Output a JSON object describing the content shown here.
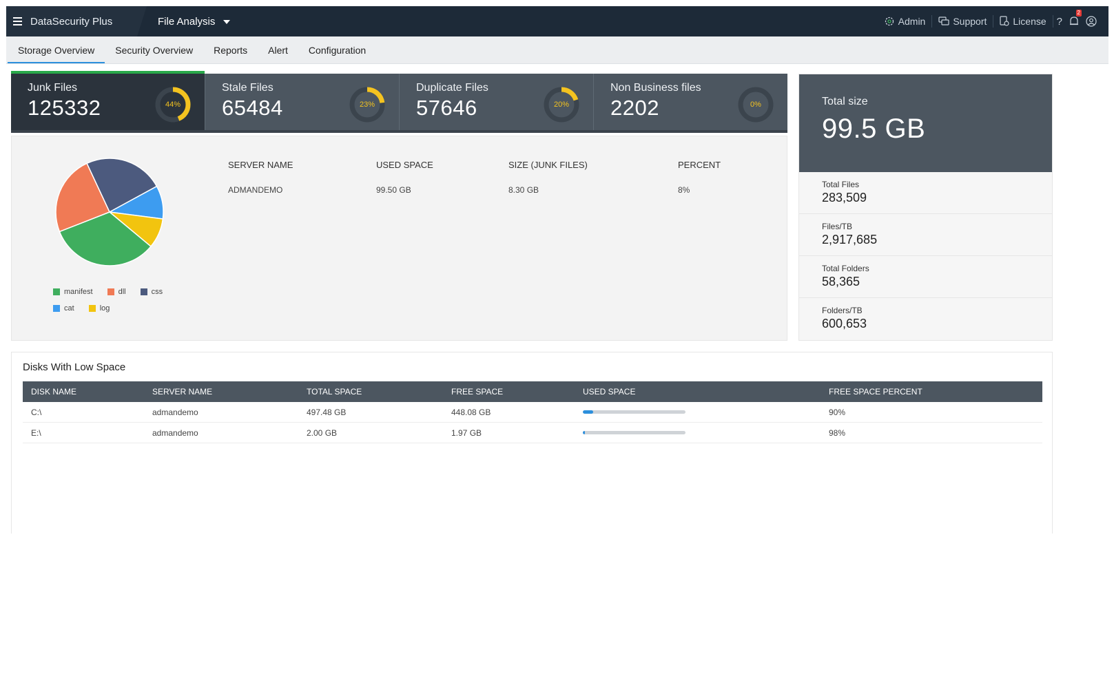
{
  "topbar": {
    "brand": "DataSecurity Plus",
    "module": "File Analysis",
    "admin": "Admin",
    "support": "Support",
    "license": "License",
    "help": "?",
    "notification_count": "2"
  },
  "tabs": [
    {
      "label": "Storage Overview",
      "active": true
    },
    {
      "label": "Security Overview",
      "active": false
    },
    {
      "label": "Reports",
      "active": false
    },
    {
      "label": "Alert",
      "active": false
    },
    {
      "label": "Configuration",
      "active": false
    }
  ],
  "stats": [
    {
      "title": "Junk Files",
      "value": "125332",
      "percent_label": "44%",
      "percent": 44
    },
    {
      "title": "Stale Files",
      "value": "65484",
      "percent_label": "23%",
      "percent": 23
    },
    {
      "title": "Duplicate Files",
      "value": "57646",
      "percent_label": "20%",
      "percent": 20
    },
    {
      "title": "Non Business files",
      "value": "2202",
      "percent_label": "0%",
      "percent": 0
    }
  ],
  "pie": {
    "legend": [
      {
        "label": "manifest",
        "color": "#3fae5e"
      },
      {
        "label": "dll",
        "color": "#f07a55"
      },
      {
        "label": "css",
        "color": "#4c5a7e"
      },
      {
        "label": "cat",
        "color": "#3d9cf0"
      },
      {
        "label": "log",
        "color": "#f2c40f"
      }
    ],
    "shares": {
      "manifest": 33,
      "dll": 24,
      "css": 24,
      "cat": 10,
      "log": 9
    }
  },
  "junk_table": {
    "headers": [
      "SERVER NAME",
      "USED SPACE",
      "SIZE (JUNK FILES)",
      "PERCENT"
    ],
    "rows": [
      [
        "ADMANDEMO",
        "99.50 GB",
        "8.30 GB",
        "8%"
      ]
    ]
  },
  "summary": {
    "total_size_label": "Total size",
    "total_size": "99.5 GB",
    "items": [
      {
        "label": "Total Files",
        "value": "283,509"
      },
      {
        "label": "Files/TB",
        "value": "2,917,685"
      },
      {
        "label": "Total Folders",
        "value": "58,365"
      },
      {
        "label": "Folders/TB",
        "value": "600,653"
      }
    ]
  },
  "disks": {
    "title": "Disks With Low Space",
    "headers": [
      "DISK NAME",
      "SERVER NAME",
      "TOTAL SPACE",
      "FREE SPACE",
      "USED SPACE",
      "FREE SPACE PERCENT"
    ],
    "rows": [
      {
        "disk": "C:\\",
        "server": "admandemo",
        "total": "497.48 GB",
        "free": "448.08 GB",
        "used_fraction": 0.1,
        "free_percent": "90%"
      },
      {
        "disk": "E:\\",
        "server": "admandemo",
        "total": "2.00 GB",
        "free": "1.97 GB",
        "used_fraction": 0.02,
        "free_percent": "98%"
      }
    ]
  }
}
